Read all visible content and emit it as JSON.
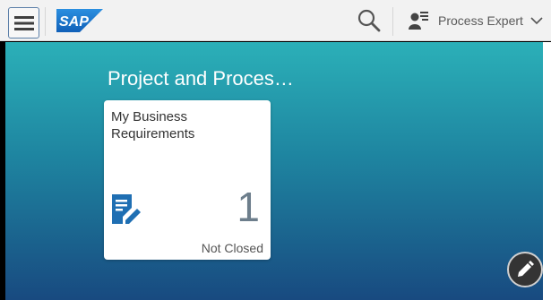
{
  "header": {
    "menu_icon": "hamburger-menu-icon",
    "logo_text": "SAP",
    "search_icon": "search-icon",
    "user": {
      "icon": "user-list-icon",
      "label": "Process Expert",
      "chevron_icon": "chevron-down-icon"
    }
  },
  "group": {
    "title": "Project and Proces…"
  },
  "tiles": [
    {
      "title": "My Business Requirements",
      "icon": "edit-document-icon",
      "number": "1",
      "footer": "Not Closed"
    }
  ],
  "fab": {
    "icon": "pencil-icon"
  },
  "colors": {
    "header_bg": "#f2f2f2",
    "canvas_top": "#2bb0b8",
    "canvas_bottom": "#184a80",
    "sap_blue": "#1d6fc9",
    "tile_icon": "#1f6fb3"
  }
}
